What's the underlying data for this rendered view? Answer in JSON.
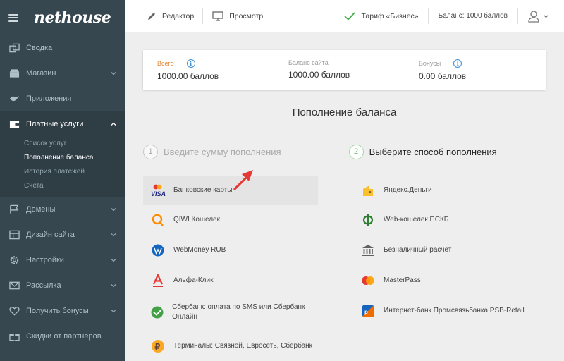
{
  "brand": {
    "logo": "nethouse"
  },
  "sidebar": {
    "items": [
      {
        "label": "Сводка",
        "icon": "dashboard-icon"
      },
      {
        "label": "Магазин",
        "icon": "shop-icon",
        "expandable": true
      },
      {
        "label": "Приложения",
        "icon": "apps-icon"
      },
      {
        "label": "Платные услуги",
        "icon": "wallet-icon",
        "expandable": true,
        "active": true
      },
      {
        "label": "Домены",
        "icon": "flag-icon",
        "expandable": true
      },
      {
        "label": "Дизайн сайта",
        "icon": "layout-icon",
        "expandable": true
      },
      {
        "label": "Настройки",
        "icon": "gear-icon",
        "expandable": true
      },
      {
        "label": "Рассылка",
        "icon": "mail-icon",
        "expandable": true
      },
      {
        "label": "Получить бонусы",
        "icon": "heart-icon",
        "expandable": true
      },
      {
        "label": "Скидки от партнеров",
        "icon": "gift-icon"
      }
    ],
    "subitems": [
      {
        "label": "Список услуг"
      },
      {
        "label": "Пополнение баланса",
        "current": true
      },
      {
        "label": "История платежей"
      },
      {
        "label": "Счета"
      }
    ]
  },
  "topbar": {
    "editor": "Редактор",
    "preview": "Просмотр",
    "tariff": "Тариф «Бизнес»",
    "balance": "Баланс: 1000 баллов"
  },
  "balance_card": {
    "total_label": "Всего",
    "total_value": "1000.00 баллов",
    "site_label": "Баланс сайта",
    "site_value": "1000.00 баллов",
    "bonus_label": "Бонусы",
    "bonus_value": "0.00 баллов"
  },
  "page": {
    "title": "Пополнение баланса",
    "step1_num": "1",
    "step1_label": "Введите сумму пополнения",
    "step2_num": "2",
    "step2_label": "Выберите способ пополнения"
  },
  "payment_methods": {
    "left": [
      {
        "label": "Банковские карты",
        "icon": "visa-card-icon",
        "selected": true
      },
      {
        "label": "QIWI Кошелек",
        "icon": "qiwi-icon"
      },
      {
        "label": "WebMoney RUB",
        "icon": "webmoney-icon"
      },
      {
        "label": "Альфа-Клик",
        "icon": "alfa-icon"
      },
      {
        "label": "Сбербанк: оплата по SMS или Сбербанк Онлайн",
        "icon": "sberbank-icon"
      },
      {
        "label": "Терминалы: Связной, Евросеть, Сбербанк",
        "icon": "terminal-icon"
      }
    ],
    "right": [
      {
        "label": "Яндекс.Деньги",
        "icon": "yandex-money-icon"
      },
      {
        "label": "Web-кошелек ПСКБ",
        "icon": "pskb-icon"
      },
      {
        "label": "Безналичный расчет",
        "icon": "bank-icon"
      },
      {
        "label": "MasterPass",
        "icon": "masterpass-icon"
      },
      {
        "label": "Интернет-банк Промсвязьбанка PSB-Retail",
        "icon": "psb-icon"
      }
    ]
  },
  "colors": {
    "sidebar": "#37474f",
    "accent_green": "#4caf50",
    "info_blue": "#3a8ed8",
    "arrow_red": "#e53935"
  }
}
